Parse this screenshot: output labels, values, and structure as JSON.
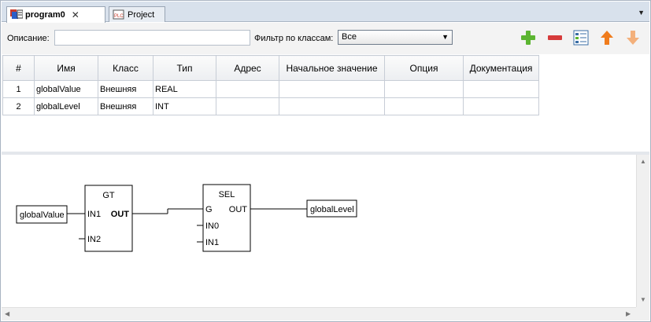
{
  "tabs": [
    {
      "label": "program0",
      "active": true
    },
    {
      "label": "Project",
      "active": false
    }
  ],
  "toolbar": {
    "description_label": "Описание:",
    "description_value": "",
    "filter_label": "Фильтр по классам:",
    "filter_value": "Все",
    "buttons": [
      "add-icon",
      "remove-icon",
      "checklist-icon",
      "move-up-icon",
      "move-down-icon"
    ]
  },
  "table": {
    "columns": [
      "#",
      "Имя",
      "Класс",
      "Тип",
      "Адрес",
      "Начальное значение",
      "Опция",
      "Документация"
    ],
    "rows": [
      [
        "1",
        "globalValue",
        "Внешняя",
        "REAL",
        "",
        "",
        "",
        ""
      ],
      [
        "2",
        "globalLevel",
        "Внешняя",
        "INT",
        "",
        "",
        "",
        ""
      ]
    ]
  },
  "diagram": {
    "input_var": "globalValue",
    "output_var": "globalLevel",
    "gt_block": {
      "name": "GT",
      "pins": [
        "IN1",
        "IN2",
        "OUT"
      ]
    },
    "sel_block": {
      "name": "SEL",
      "pins": [
        "G",
        "IN0",
        "IN1",
        "OUT"
      ]
    }
  },
  "colors": {
    "add": "#5cb531",
    "remove": "#d63b3b",
    "up": "#f07c1c",
    "down": "#f3b07b"
  }
}
